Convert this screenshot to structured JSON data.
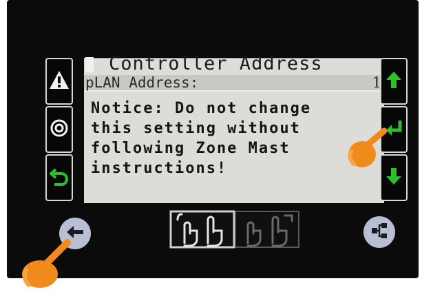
{
  "screen": {
    "title": "Controller Address",
    "address_label": "pLAN Address:",
    "address_value": "1",
    "notice_lines": [
      "Notice: Do not change",
      "this setting without",
      "following Zone Mast",
      "instructions!"
    ]
  },
  "buttons": {
    "left": [
      "alarm-button",
      "program-button",
      "escape-button"
    ],
    "right": [
      "up-button",
      "enter-button",
      "down-button"
    ],
    "bottom": [
      "back-button",
      "touch-keys-area",
      "menu-tree-button"
    ]
  },
  "icons": {
    "alarm": "warning-triangle-icon",
    "program": "circle-icon",
    "escape": "return-arrow-icon",
    "up": "arrow-up-icon",
    "enter": "enter-arrow-icon",
    "down": "arrow-down-icon",
    "back": "arrow-left-icon",
    "menu": "tree-icon",
    "pointer": "pointing-hand-icon"
  },
  "colors": {
    "bezel": "#0b0b0b",
    "display_bg": "#ddddd8",
    "key_green": "#2fbf2c",
    "pointer_orange": "#f08a1a",
    "round_button": "#b9bfd2"
  }
}
